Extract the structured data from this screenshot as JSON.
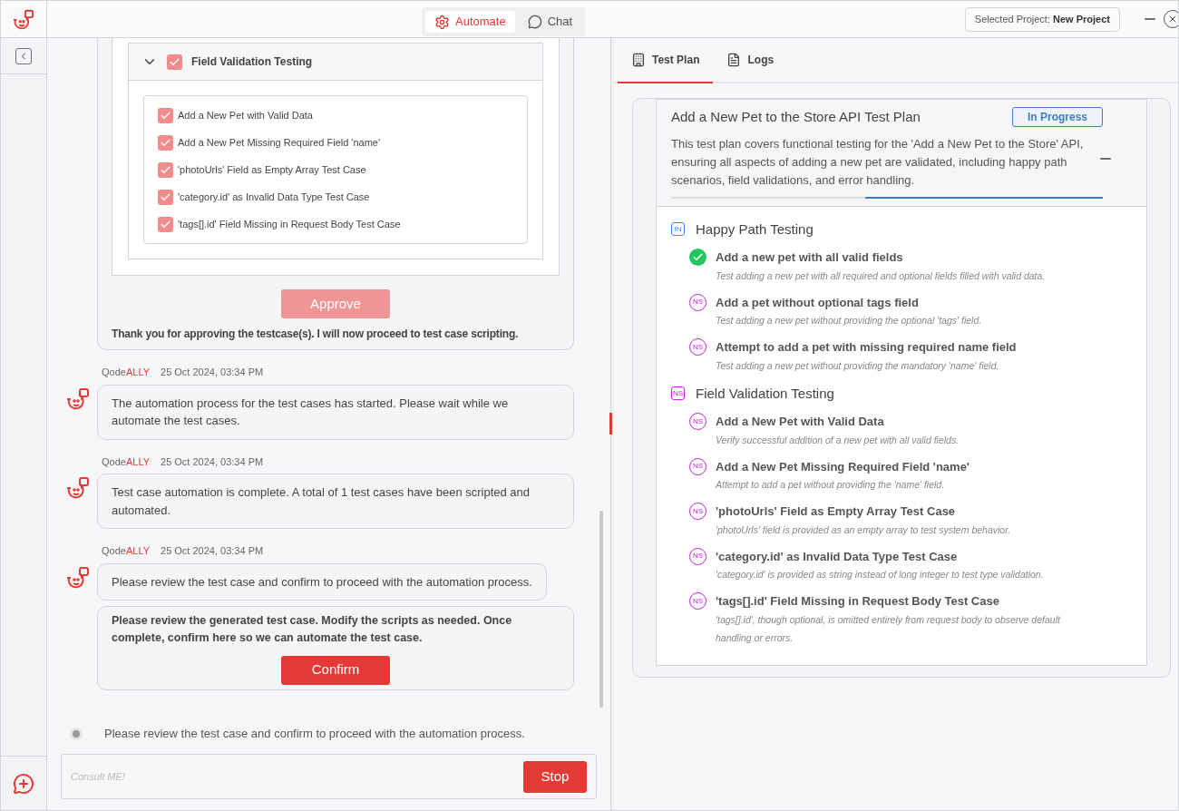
{
  "header": {
    "tabs": [
      {
        "label": "Automate",
        "selected": true
      },
      {
        "label": "Chat",
        "selected": false
      }
    ],
    "project_label": "Selected Project:",
    "project_name": "New Project"
  },
  "chat": {
    "approval_card": {
      "group": {
        "title": "Field Validation Testing",
        "expanded": true,
        "checked": true,
        "cases": [
          {
            "label": "Add a New Pet with Valid Data",
            "checked": true
          },
          {
            "label": "Add a New Pet Missing Required Field 'name'",
            "checked": true
          },
          {
            "label": "'photoUrls' Field as Empty Array Test Case",
            "checked": true
          },
          {
            "label": "'category.id' as Invalid Data Type Test Case",
            "checked": true
          },
          {
            "label": "'tags[].id' Field Missing in Request Body Test Case",
            "checked": true
          }
        ]
      },
      "button": {
        "label": "Approve",
        "disabled": true
      },
      "note": "Thank you for approving the testcase(s). I will now proceed to test case scripting."
    },
    "messages": [
      {
        "sender_prefix": "Qode",
        "sender_suffix": "ALLY",
        "time": "25 Oct 2024, 03:34 PM",
        "text": "The automation process for the test cases has started. Please wait while we automate the test cases."
      },
      {
        "sender_prefix": "Qode",
        "sender_suffix": "ALLY",
        "time": "25 Oct 2024, 03:34 PM",
        "text": "Test case automation is complete. A total of 1 test cases have been scripted and automated."
      },
      {
        "sender_prefix": "Qode",
        "sender_suffix": "ALLY",
        "time": "25 Oct 2024, 03:34 PM",
        "text": "Please review the test case and confirm to proceed with the automation process.",
        "action": {
          "text": "Please review the generated test case. Modify the scripts as needed. Once complete, confirm here so we can automate the test case.",
          "button": {
            "label": "Confirm",
            "disabled": false
          }
        }
      }
    ],
    "status": "Please review the test case and confirm to proceed with the automation process.",
    "input": {
      "placeholder": "Consult ME!"
    },
    "stop_button": "Stop"
  },
  "right": {
    "tabs": [
      {
        "label": "Test Plan",
        "selected": true
      },
      {
        "label": "Logs",
        "selected": false
      }
    ],
    "plan": {
      "title": "Add a New Pet to the Store API Test Plan",
      "status": "In Progress",
      "description": "This test plan covers functional testing for the 'Add a New Pet to the Store' API, ensuring all aspects of adding a new pet are validated, including happy path scenarios, field validations, and error handling.",
      "level": 0.55,
      "groups": [
        {
          "title": "Happy Path Testing",
          "badge": "IN",
          "color": "#3b82f6",
          "cases": [
            {
              "kind": "passed",
              "title": "Add a new pet with all valid fields",
              "description": "Test adding a new pet with all required and optional fields filled with valid data."
            },
            {
              "kind": "pending",
              "badge": "NS",
              "title": "Add a pet without optional tags field",
              "description": "Test adding a new pet without providing the optional 'tags' field."
            },
            {
              "kind": "pending",
              "badge": "NS",
              "title": "Attempt to add a pet with missing required name field",
              "description": "Test adding a new pet without providing the mandatory 'name' field."
            }
          ]
        },
        {
          "title": "Field Validation Testing",
          "badge": "NS",
          "color": "#c026d3",
          "cases": [
            {
              "kind": "pending",
              "badge": "NS",
              "title": "Add a New Pet with Valid Data",
              "description": "Verify successful addition of a new pet with all valid fields."
            },
            {
              "kind": "pending",
              "badge": "NS",
              "title": "Add a New Pet Missing Required Field 'name'",
              "description": "Attempt to add a pet without providing the 'name' field."
            },
            {
              "kind": "pending",
              "badge": "NS",
              "title": "'photoUrls' Field as Empty Array Test Case",
              "description": "'photoUrls' field is provided as an empty array to test system behavior."
            },
            {
              "kind": "pending",
              "badge": "NS",
              "title": "'category.id' as Invalid Data Type Test Case",
              "description": "'category.id' is provided as string instead of long integer to test type validation."
            },
            {
              "kind": "pending",
              "badge": "NS",
              "title": "'tags[].id' Field Missing in Request Body Test Case",
              "description": "'tags[].id', though optional, is omitted entirely from request body to observe default handling or errors."
            }
          ]
        }
      ]
    }
  }
}
